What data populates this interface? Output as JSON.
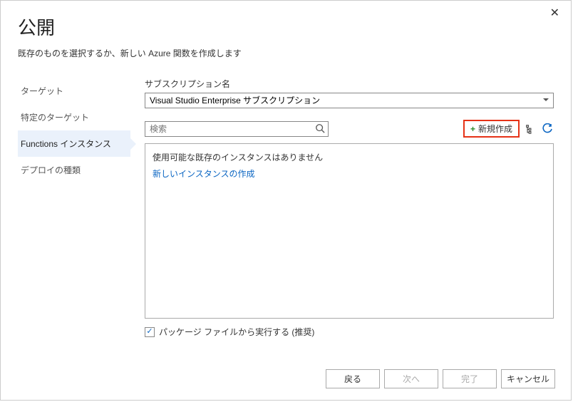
{
  "header": {
    "title": "公開",
    "subtitle": "既存のものを選択するか、新しい Azure 関数を作成します"
  },
  "nav": {
    "items": [
      {
        "label": "ターゲット"
      },
      {
        "label": "特定のターゲット"
      },
      {
        "label": "Functions インスタンス"
      },
      {
        "label": "デプロイの種類"
      }
    ],
    "activeIndex": 2
  },
  "subscription": {
    "label": "サブスクリプション名",
    "value": "Visual Studio Enterprise サブスクリプション"
  },
  "search": {
    "placeholder": "検索"
  },
  "toolbar": {
    "new_label": "新規作成"
  },
  "instances": {
    "empty_text": "使用可能な既存のインスタンスはありません",
    "create_link": "新しいインスタンスの作成"
  },
  "checkbox": {
    "label": "パッケージ ファイルから実行する (推奨)",
    "checked": true
  },
  "footer": {
    "back": "戻る",
    "next": "次へ",
    "finish": "完了",
    "cancel": "キャンセル"
  }
}
